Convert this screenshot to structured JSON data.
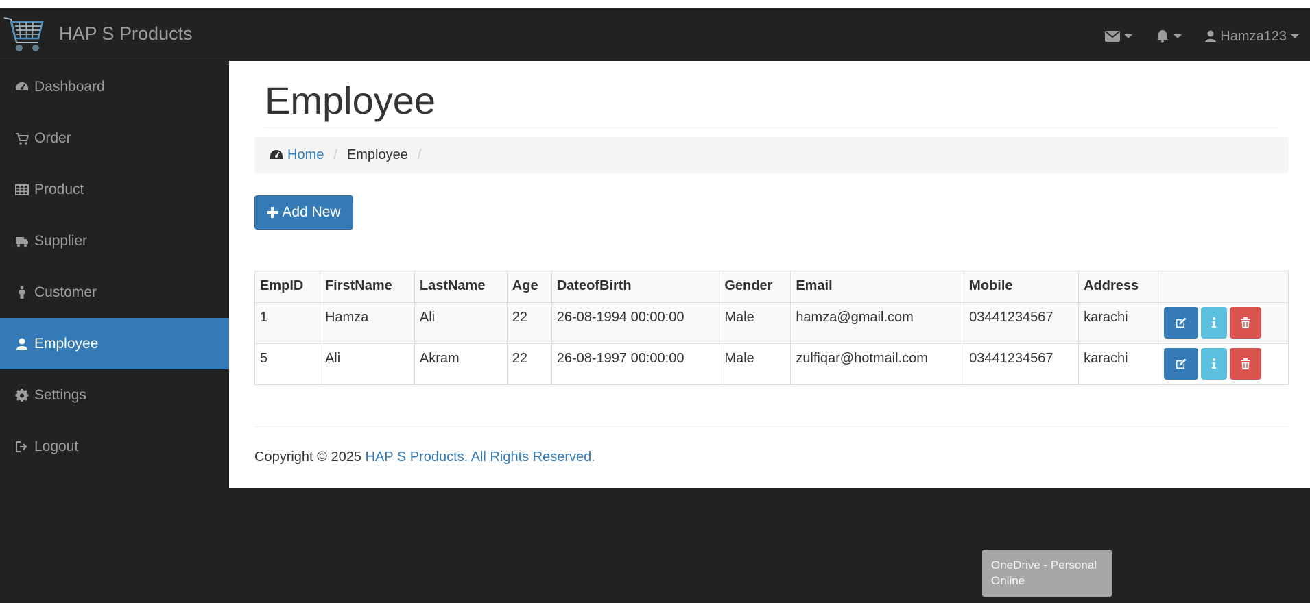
{
  "app": {
    "title": "HAP S Products"
  },
  "header": {
    "user_name": "Hamza123"
  },
  "sidebar": {
    "items": [
      {
        "label": "Dashboard",
        "icon": "dashboard-icon"
      },
      {
        "label": "Order",
        "icon": "cart-icon"
      },
      {
        "label": "Product",
        "icon": "table-icon"
      },
      {
        "label": "Supplier",
        "icon": "truck-icon"
      },
      {
        "label": "Customer",
        "icon": "male-icon"
      },
      {
        "label": "Employee",
        "icon": "user-icon",
        "active": true
      },
      {
        "label": "Settings",
        "icon": "gear-icon"
      },
      {
        "label": "Logout",
        "icon": "sign-out-icon"
      }
    ]
  },
  "page": {
    "title": "Employee",
    "breadcrumb": {
      "home": "Home",
      "current": "Employee",
      "sep": "/"
    },
    "add_button": "Add New"
  },
  "table": {
    "headers": [
      "EmpID",
      "FirstName",
      "LastName",
      "Age",
      "DateofBirth",
      "Gender",
      "Email",
      "Mobile",
      "Address",
      ""
    ],
    "rows": [
      [
        "1",
        "Hamza",
        "Ali",
        "22",
        "26-08-1994 00:00:00",
        "Male",
        "hamza@gmail.com",
        "03441234567",
        "karachi"
      ],
      [
        "5",
        "Ali",
        "Akram",
        "22",
        "26-08-1997 00:00:00",
        "Male",
        "zulfiqar@hotmail.com",
        "03441234567",
        "karachi"
      ]
    ]
  },
  "footer": {
    "prefix": "Copyright © 2025 ",
    "link": "HAP S Products. All Rights Reserved."
  },
  "toast": {
    "line1": "OneDrive - Personal",
    "line2": "Online"
  },
  "colors": {
    "primary": "#337ab7",
    "info": "#5bc0de",
    "danger": "#d9534f",
    "nav_bg": "#222222"
  }
}
